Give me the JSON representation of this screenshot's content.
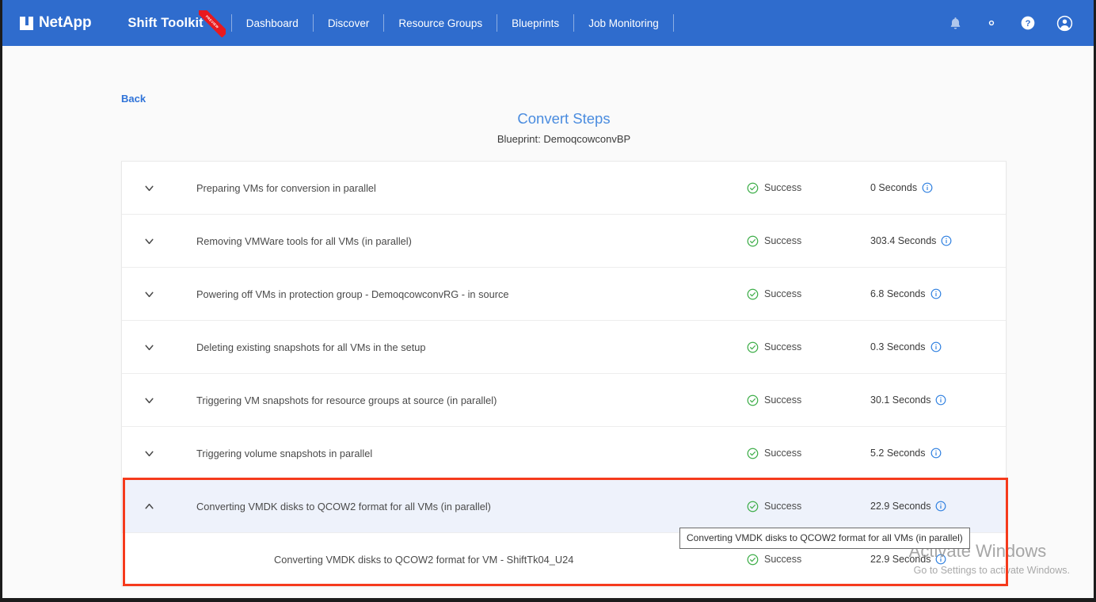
{
  "header": {
    "brand": "NetApp",
    "app_name": "Shift Toolkit",
    "ribbon_label": "PREVIEW",
    "nav_items": [
      {
        "label": "Dashboard"
      },
      {
        "label": "Discover"
      },
      {
        "label": "Resource Groups"
      },
      {
        "label": "Blueprints"
      },
      {
        "label": "Job Monitoring"
      }
    ],
    "icons": [
      {
        "name": "notification-bell-icon"
      },
      {
        "name": "settings-gear-icon"
      },
      {
        "name": "help-circle-icon"
      },
      {
        "name": "user-account-icon"
      }
    ],
    "colors": {
      "bar_bg": "#2f6ccd",
      "ribbon": "#e8191e"
    }
  },
  "page": {
    "back_label": "Back",
    "title": "Convert Steps",
    "subtitle": "Blueprint: DemoqcowconvBP",
    "title_color": "#4a8cdf",
    "link_color": "#2f73d8"
  },
  "steps": [
    {
      "label": "Preparing VMs for conversion in parallel",
      "status": "Success",
      "duration": "0 Seconds",
      "expanded": false
    },
    {
      "label": "Removing VMWare tools for all VMs (in parallel)",
      "status": "Success",
      "duration": "303.4 Seconds",
      "expanded": false
    },
    {
      "label": "Powering off VMs in protection group - DemoqcowconvRG - in source",
      "status": "Success",
      "duration": "6.8 Seconds",
      "expanded": false
    },
    {
      "label": "Deleting existing snapshots for all VMs in the setup",
      "status": "Success",
      "duration": "0.3 Seconds",
      "expanded": false
    },
    {
      "label": "Triggering VM snapshots for resource groups at source (in parallel)",
      "status": "Success",
      "duration": "30.1 Seconds",
      "expanded": false
    },
    {
      "label": "Triggering volume snapshots in parallel",
      "status": "Success",
      "duration": "5.2 Seconds",
      "expanded": false
    },
    {
      "label": "Converting VMDK disks to QCOW2 format for all VMs (in parallel)",
      "status": "Success",
      "duration": "22.9 Seconds",
      "expanded": true
    }
  ],
  "sub_step": {
    "label": "Converting VMDK disks to QCOW2 format for VM - ShiftTk04_U24",
    "status": "Success",
    "duration": "22.9 Seconds"
  },
  "tooltip": {
    "text": "Converting VMDK disks to QCOW2 format for all VMs (in parallel)"
  },
  "annotation": {
    "highlight_color": "#f53a1c"
  },
  "watermark": {
    "title": "Activate Windows",
    "subtitle": "Go to Settings to activate Windows."
  },
  "status_colors": {
    "success": "#3fae4a",
    "info": "#2f80e0"
  }
}
